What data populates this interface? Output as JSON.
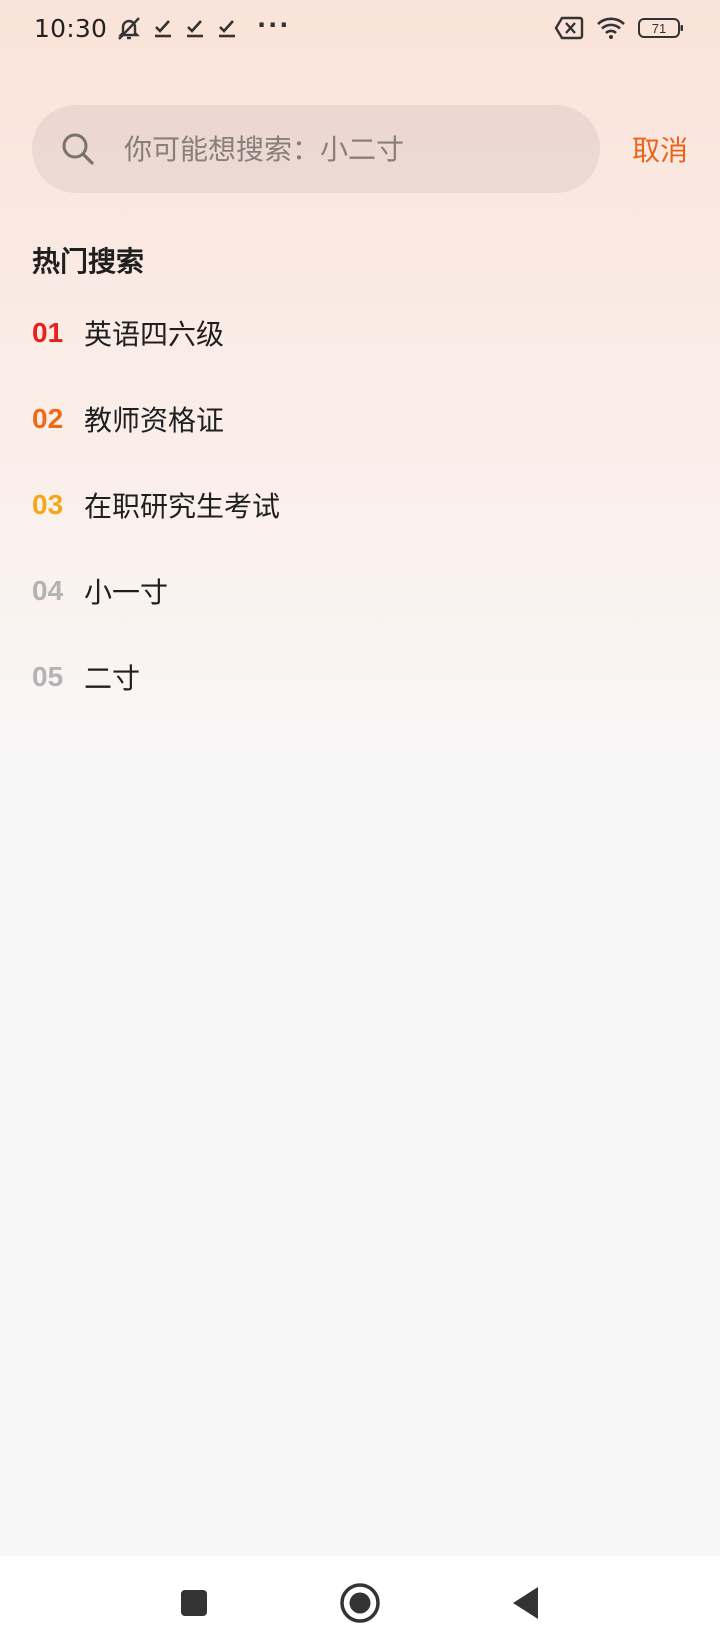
{
  "status_bar": {
    "time": "10:30",
    "battery": "71",
    "icons": [
      "mute-icon",
      "check-icon",
      "check-icon",
      "check-icon",
      "more-icon",
      "sim-error-icon",
      "wifi-icon",
      "battery-icon"
    ],
    "more_glyph": "···"
  },
  "search": {
    "placeholder": "你可能想搜索：小二寸",
    "value": "",
    "cancel_label": "取消",
    "icon": "search-icon"
  },
  "hot": {
    "title": "热门搜索",
    "items": [
      {
        "rank": "01",
        "text": "英语四六级",
        "color": "#e8201f"
      },
      {
        "rank": "02",
        "text": "教师资格证",
        "color": "#ee6a1a"
      },
      {
        "rank": "03",
        "text": "在职研究生考试",
        "color": "#f3a71b"
      },
      {
        "rank": "04",
        "text": "小一寸",
        "color": "#b3b3b3"
      },
      {
        "rank": "05",
        "text": "二寸",
        "color": "#b3b3b3"
      }
    ]
  },
  "nav": {
    "icons": [
      "recents-icon",
      "home-icon",
      "back-icon"
    ]
  },
  "colors": {
    "accent": "#e8651a",
    "background_top": "#fae3d9",
    "background_bottom": "#f7f7f7"
  }
}
